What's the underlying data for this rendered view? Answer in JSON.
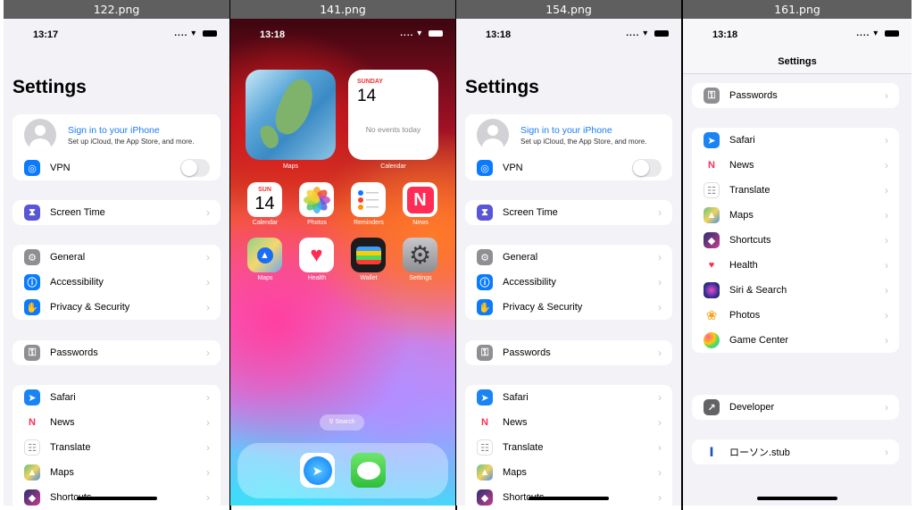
{
  "files": [
    "122.png",
    "141.png",
    "154.png",
    "161.png"
  ],
  "status": {
    "time_1": "13:17",
    "time_2": "13:18",
    "time_3": "13:18",
    "time_4": "13:18",
    "signal": "....",
    "wifi": "wifi-icon"
  },
  "settings": {
    "title": "Settings",
    "account": {
      "title": "Sign in to your iPhone",
      "subtitle": "Set up iCloud, the App Store, and more."
    },
    "vpn": "VPN",
    "screen_time": "Screen Time",
    "general": "General",
    "accessibility": "Accessibility",
    "privacy": "Privacy & Security",
    "passwords": "Passwords",
    "safari": "Safari",
    "news": "News",
    "translate": "Translate",
    "maps": "Maps",
    "shortcuts": "Shortcuts",
    "health": "Health",
    "siri": "Siri & Search",
    "photos": "Photos",
    "game_center": "Game Center",
    "developer": "Developer",
    "lawson": "ローソン.stub"
  },
  "home": {
    "widget_maps": "Maps",
    "widget_calendar": "Calendar",
    "cal_day": "SUNDAY",
    "cal_num": "14",
    "cal_events": "No events today",
    "app_cal_day": "SUN",
    "app_cal_num": "14",
    "apps_row1": [
      "Calendar",
      "Photos",
      "Reminders",
      "News"
    ],
    "apps_row2": [
      "Maps",
      "Health",
      "Wallet",
      "Settings"
    ],
    "search": "Search"
  },
  "colors": {
    "link": "#1a7cf5",
    "screen_time": "#5856d6",
    "blue": "#0a7aff",
    "gray": "#8e8e93",
    "red": "#ff3b30"
  }
}
